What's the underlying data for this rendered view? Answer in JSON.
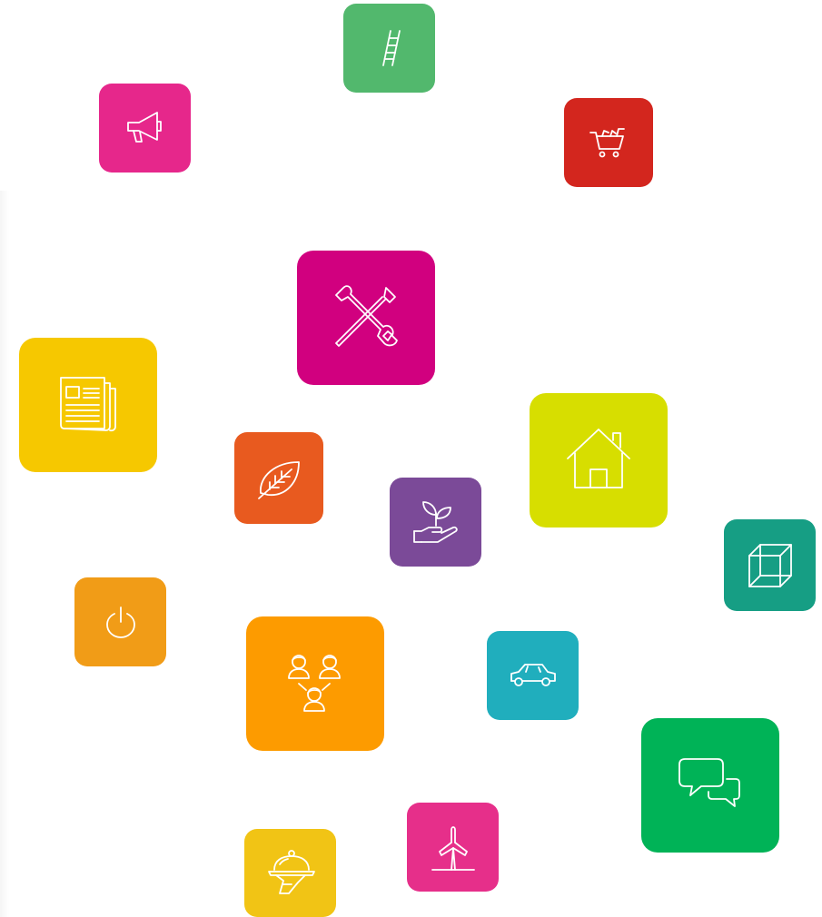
{
  "icons": [
    {
      "name": "ladder-icon",
      "color": "#52b86d"
    },
    {
      "name": "megaphone-icon",
      "color": "#e6278b"
    },
    {
      "name": "shopping-cart-icon",
      "color": "#d3261e"
    },
    {
      "name": "tools-icon",
      "color": "#d1007f"
    },
    {
      "name": "newspaper-icon",
      "color": "#f6c800"
    },
    {
      "name": "leaf-icon",
      "color": "#e85a1f"
    },
    {
      "name": "plant-hand-icon",
      "color": "#7b4a98"
    },
    {
      "name": "house-icon",
      "color": "#d7de00"
    },
    {
      "name": "cube-icon",
      "color": "#169e84"
    },
    {
      "name": "power-icon",
      "color": "#f19c17"
    },
    {
      "name": "people-network-icon",
      "color": "#fd9b00"
    },
    {
      "name": "car-icon",
      "color": "#20aebd"
    },
    {
      "name": "chat-bubbles-icon",
      "color": "#00b357"
    },
    {
      "name": "wind-turbine-icon",
      "color": "#e62f8a"
    },
    {
      "name": "serving-cloche-icon",
      "color": "#f1c415"
    }
  ]
}
